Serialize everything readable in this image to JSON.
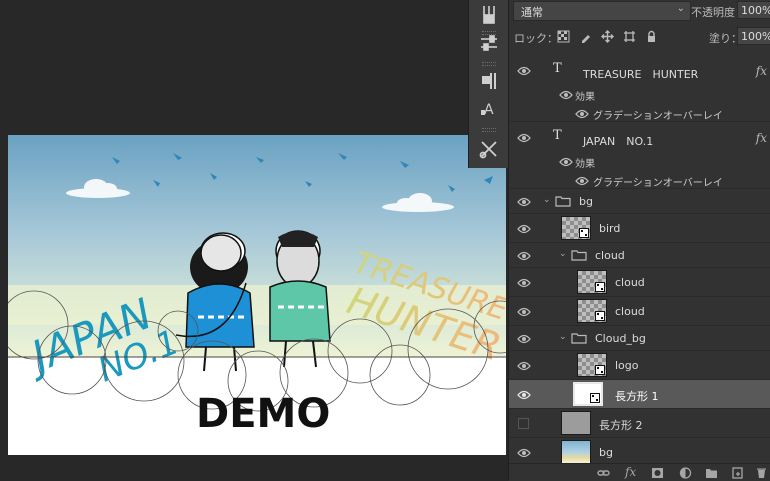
{
  "canvas": {
    "left_text_line1": "JAPAN",
    "left_text_line2": "NO.1",
    "right_text_line1": "TREASURE",
    "right_text_line2": "HUNTER",
    "watermark": "DEMO",
    "colors": {
      "sky_top": "#6ea4c4",
      "japan_text": "#1b98be",
      "treasure_text": "#e6c47a",
      "demo_text": "#111111"
    }
  },
  "tools": [
    "brush-settings-icon",
    "adjustments-icon",
    "paragraph-icon",
    "character-icon",
    "tool-presets-icon"
  ],
  "layers_panel": {
    "blend_mode": "通常",
    "opacity_label": "不透明度：",
    "opacity_value": "100%",
    "lock_label": "ロック：",
    "fill_label": "塗り：",
    "fill_value": "100%",
    "fx_symbol": "fx",
    "layers": [
      {
        "name": "TREASURE　HUNTER",
        "type": "text",
        "effects_label": "効果",
        "effect": "グラデーションオーバーレイ"
      },
      {
        "name": "JAPAN　NO.1",
        "type": "text",
        "effects_label": "効果",
        "effect": "グラデーションオーバーレイ"
      },
      {
        "name": "bg",
        "type": "group"
      },
      {
        "name": "bird",
        "type": "smart"
      },
      {
        "name": "cloud",
        "type": "group"
      },
      {
        "name": "cloud",
        "type": "smart"
      },
      {
        "name": "cloud",
        "type": "smart"
      },
      {
        "name": "Cloud_bg",
        "type": "group"
      },
      {
        "name": "logo",
        "type": "smart"
      },
      {
        "name": "長方形 1",
        "type": "smart",
        "selected": true
      },
      {
        "name": "長方形 2",
        "type": "shape",
        "visible": false
      },
      {
        "name": "bg",
        "type": "image"
      }
    ]
  },
  "footer_icons": [
    "link-icon",
    "fx-icon",
    "mask-icon",
    "adjustment-layer-icon",
    "new-group-icon",
    "new-layer-icon",
    "trash-icon"
  ]
}
